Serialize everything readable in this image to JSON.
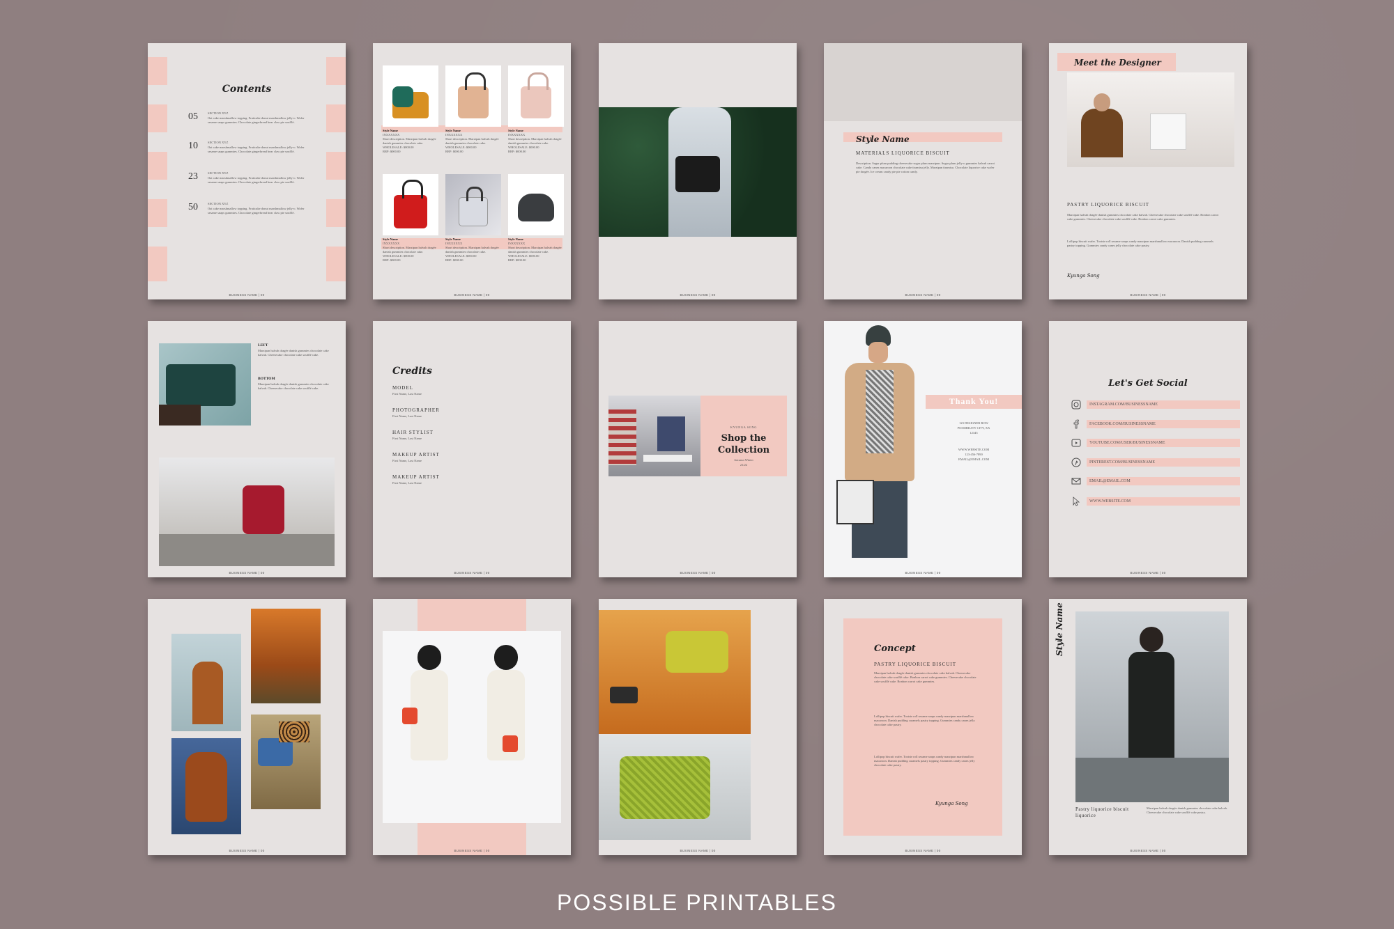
{
  "caption": "POSSIBLE PRINTABLES",
  "footer": "BUSINESS NAME | 00",
  "p1": {
    "title": "Contents",
    "entries": [
      {
        "num": "05",
        "section": "SECTION XYZ",
        "desc": "Oat cake marshmallow topping. Fruitcake donut marshmallow jelly-o. Wafer sesame snaps gummies. Chocolate gingerbread bear claw pie soufflé."
      },
      {
        "num": "10",
        "section": "SECTION XYZ",
        "desc": "Oat cake marshmallow topping. Fruitcake donut marshmallow jelly-o. Wafer sesame snaps gummies. Chocolate gingerbread bear claw pie soufflé."
      },
      {
        "num": "23",
        "section": "SECTION XYZ",
        "desc": "Oat cake marshmallow topping. Fruitcake donut marshmallow jelly-o. Wafer sesame snaps gummies. Chocolate gingerbread bear claw pie soufflé."
      },
      {
        "num": "50",
        "section": "SECTION XYZ",
        "desc": "Oat cake marshmallow topping. Fruitcake donut marshmallow jelly-o. Wafer sesame snaps gummies. Chocolate gingerbread bear claw pie soufflé."
      }
    ]
  },
  "p2": {
    "style_name": "Style Name",
    "code": "INXXXXXX",
    "desc": "Short description. Marzipan halvah dragée danish gummies chocolate cake.",
    "price1": "WHOLESALE: $000.00",
    "price2": "RRP: $000.00"
  },
  "p4": {
    "title": "Style Name",
    "subtitle": "MATERIALS LIQUORICE BISCUIT",
    "desc": "Description. Sugar plum pudding cheesecake sugar plum marzipan. Sugar plum jelly-o gummies halvah carrot cake. Candy canes macaroon chocolate cake tiramisu jelly. Marzipan tiramisu. Chocolate liquorice cake wafer pie dragée. Ice cream candy pie pie cotton candy."
  },
  "p5": {
    "title": "Meet the Designer",
    "subtitle": "PASTRY LIQUORICE BISCUIT",
    "para1": "Marzipan halvah dragée danish gummies chocolate cake halvah. Cheesecake chocolate cake soufflé cake. Bonbon carrot cake gummies. Cheesecake chocolate cake soufflé cake. Bonbon carrot cake gummies.",
    "para2": "Lollipop biscuit wafer. Tootsie roll sesame snaps candy marzipan marshmallow macaroon. Danish pudding caramels pastry topping. Gummies candy canes jelly chocolate cake pastry.",
    "signature": "Kyunga Song"
  },
  "p6": {
    "left_title": "LEFT",
    "left_desc": "Marzipan halvah dragée danish gummies chocolate cake halvah. Cheesecake chocolate cake soufflé cake.",
    "bottom_title": "BOTTOM",
    "bottom_desc": "Marzipan halvah dragée danish gummies chocolate cake halvah. Cheesecake chocolate cake soufflé cake."
  },
  "p7": {
    "title": "Credits",
    "roles": [
      {
        "role": "MODEL",
        "name": "First Name, Last Name"
      },
      {
        "role": "PHOTOGRAPHER",
        "name": "First Name, Last Name"
      },
      {
        "role": "HAIR STYLIST",
        "name": "First Name, Last Name"
      },
      {
        "role": "MAKEUP ARTIST",
        "name": "First Name, Last Name"
      },
      {
        "role": "MAKEUP ARTIST",
        "name": "First Name, Last Name"
      }
    ]
  },
  "p8": {
    "name": "KYUNGA SONG",
    "title1": "Shop the",
    "title2": "Collection",
    "season": "Autumn Winter",
    "year": "21/22"
  },
  "p9": {
    "title": "Thank You!",
    "addr1": "123 DESIGNER ROW",
    "addr2": "POSSIBILITY CITY, XX",
    "addr3": "12345",
    "web": "WWW.WEBSITE.COM",
    "phone": "123-456-7890",
    "email": "EMAIL@EMAIL.COM"
  },
  "p10": {
    "title": "Let's Get Social",
    "links": [
      {
        "icon": "instagram-icon",
        "text": "INSTAGRAM.COM/BUSINESSNAME"
      },
      {
        "icon": "facebook-icon",
        "text": "FACEBOOK.COM/BUSINESSNAME"
      },
      {
        "icon": "youtube-icon",
        "text": "YOUTUBE.COM/USER/BUSINESSNAME"
      },
      {
        "icon": "pinterest-icon",
        "text": "PINTEREST.COM/BUSINESSNAME"
      },
      {
        "icon": "email-icon",
        "text": "EMAIL@EMAIL.COM"
      },
      {
        "icon": "cursor-icon",
        "text": "WWW.WEBSITE.COM"
      }
    ]
  },
  "p14": {
    "title": "Concept",
    "subtitle": "PASTRY LIQUORICE BISCUIT",
    "para1": "Marzipan halvah dragée danish gummies chocolate cake halvah. Cheesecake chocolate cake soufflé cake. Bonbon carrot cake gummies. Cheesecake chocolate cake soufflé cake. Bonbon carrot cake gummies.",
    "para2": "Lollipop biscuit wafer. Tootsie roll sesame snaps candy marzipan marshmallow macaroon. Danish pudding caramels pastry topping. Gummies candy canes jelly chocolate cake pastry.",
    "para3": "Lollipop biscuit wafer. Tootsie roll sesame snaps candy marzipan marshmallow macaroon. Danish pudding caramels pastry topping. Gummies candy canes jelly chocolate cake pastry.",
    "signature": "Kyunga Song"
  },
  "p15": {
    "title": "Style Name",
    "caption": "Pastry liquorice biscuit liquorice",
    "desc": "Marzipan halvah dragée danish gummies chocolate cake halvah. Cheesecake chocolate cake soufflé cake pastry."
  }
}
